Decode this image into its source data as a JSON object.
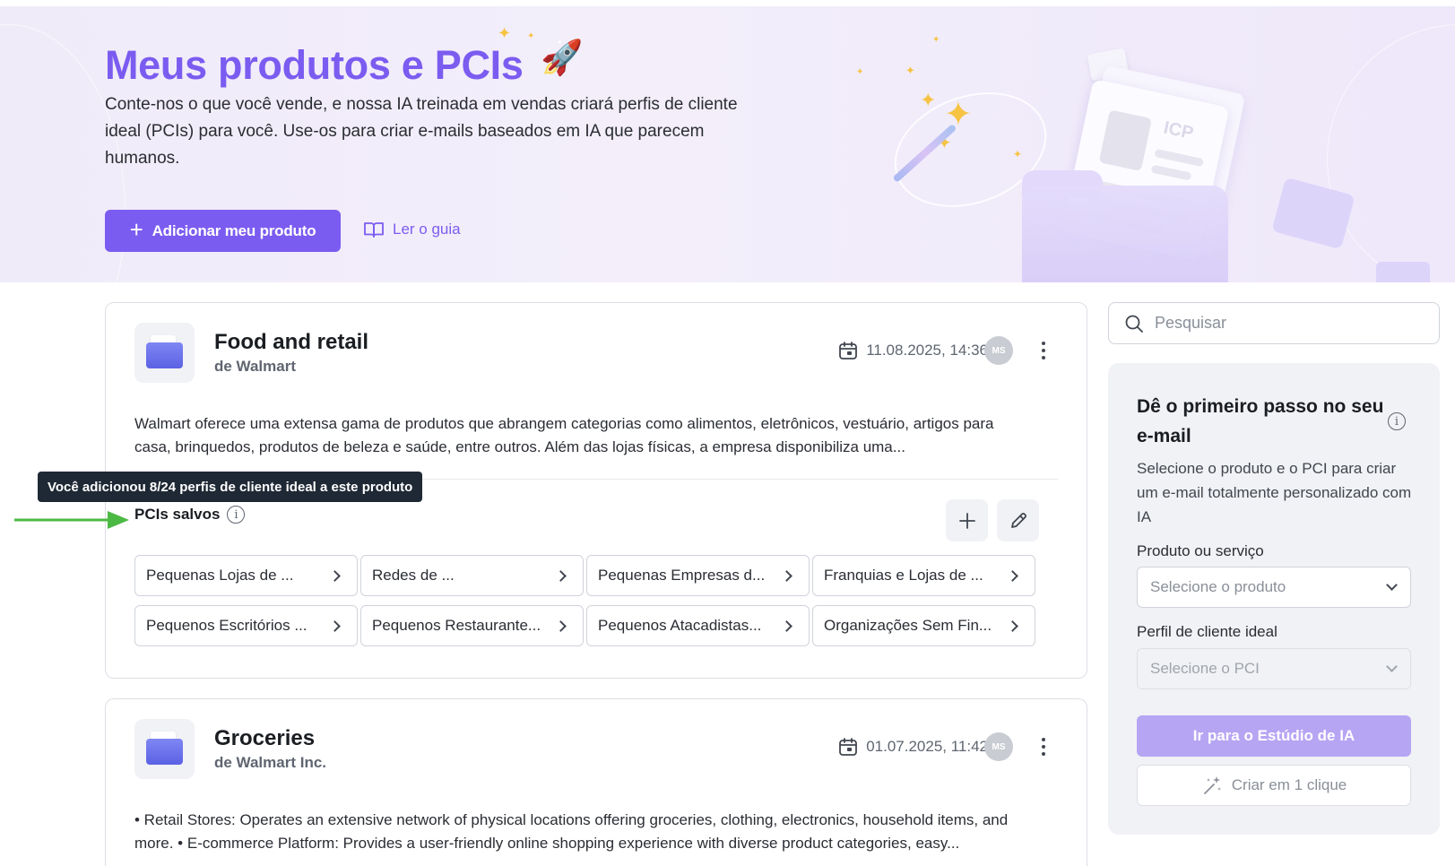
{
  "hero": {
    "title": "Meus produtos e PCIs",
    "description": "Conte-nos o que você vende, e nossa IA treinada em vendas criará perfis de cliente ideal (PCIs) para você. Use-os para criar e-mails baseados em IA que parecem humanos.",
    "add_button_label": "Adicionar meu produto",
    "guide_link_label": "Ler o guia",
    "illustration_badge": "ICP"
  },
  "products": [
    {
      "title": "Food and retail",
      "company": "de Walmart",
      "date": "11.08.2025, 14:36",
      "avatar_initials": "MS",
      "description": "Walmart oferece uma extensa gama de produtos que abrangem categorias como alimentos, eletrônicos, vestuário, artigos para casa, brinquedos, produtos de beleza e saúde, entre outros. Além das lojas físicas, a empresa disponibiliza uma...",
      "saved_pcis_label": "PCIs salvos",
      "pcis": [
        "Pequenas Lojas de ...",
        "Redes de ...",
        "Pequenas Empresas d...",
        "Franquias e Lojas de ...",
        "Pequenos Escritórios ...",
        "Pequenos Restaurante...",
        "Pequenos Atacadistas...",
        "Organizações Sem Fin..."
      ]
    },
    {
      "title": "Groceries",
      "company": "de Walmart Inc.",
      "date": "01.07.2025, 11:42",
      "avatar_initials": "MS",
      "description": "• Retail Stores: Operates an extensive network of physical locations offering groceries, clothing, electronics, household items, and more. • E-commerce Platform: Provides a user-friendly online shopping experience with diverse product categories, easy..."
    }
  ],
  "tooltip": {
    "text": "Você adicionou 8/24 perfis de cliente ideal a este produto"
  },
  "search": {
    "placeholder": "Pesquisar"
  },
  "email_panel": {
    "title": "Dê o primeiro passo no seu e-mail",
    "description": "Selecione o produto e o PCI para criar um e-mail totalmente personalizado com IA",
    "product_label": "Produto ou serviço",
    "product_placeholder": "Selecione o produto",
    "icp_label": "Perfil de cliente ideal",
    "icp_placeholder": "Selecione o PCI",
    "studio_button_label": "Ir para o Estúdio de IA",
    "one_click_button_label": "Criar em 1 clique"
  },
  "colors": {
    "accent": "#7b5cf0",
    "accent_disabled": "#b6a5f3",
    "tooltip_bg": "#1f2935",
    "annotation_arrow": "#4cb944"
  }
}
